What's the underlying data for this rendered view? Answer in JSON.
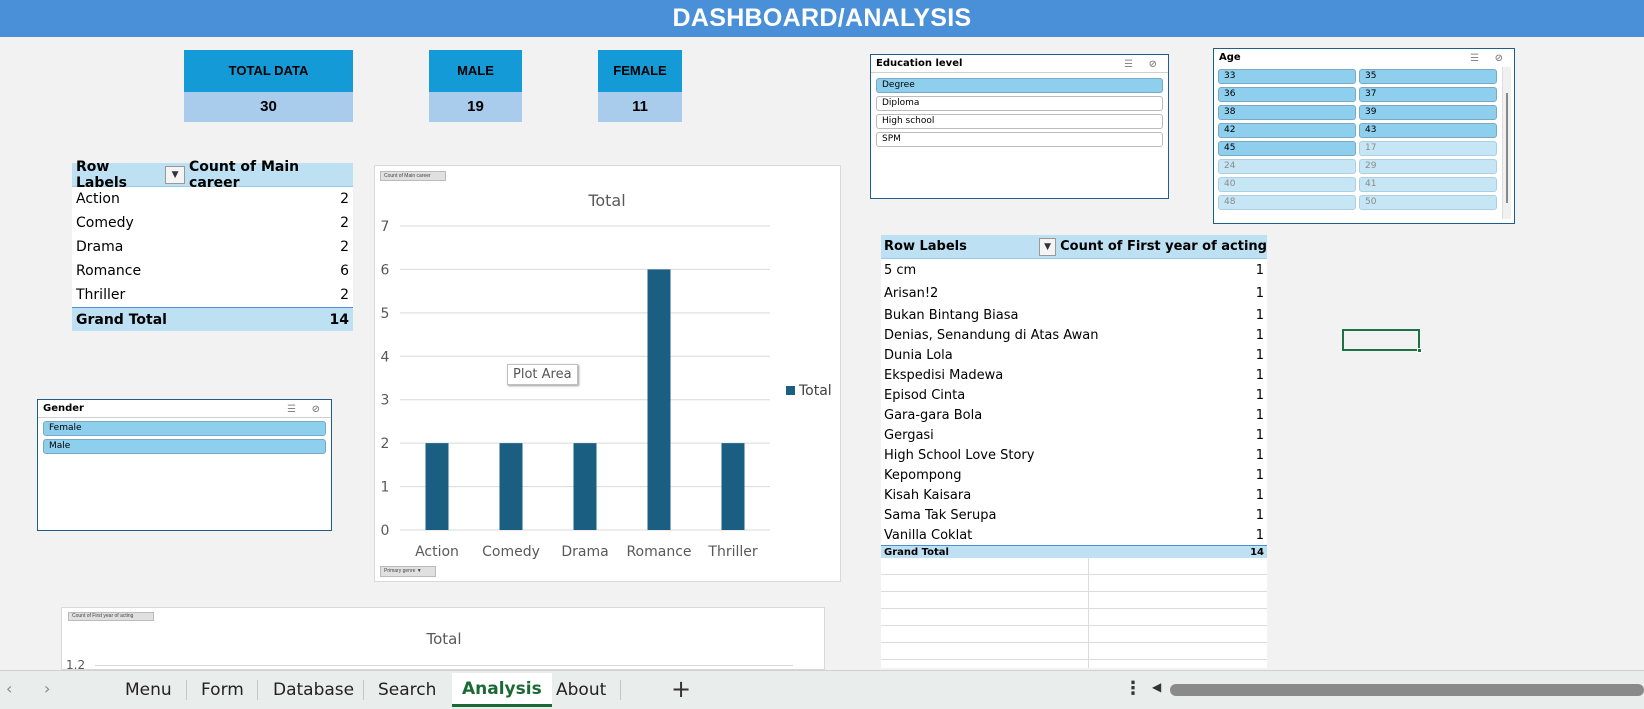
{
  "banner": {
    "title": "DASHBOARD/ANALYSIS"
  },
  "kpis": [
    {
      "label": "TOTAL DATA",
      "value": "30"
    },
    {
      "label": "MALE",
      "value": "19"
    },
    {
      "label": "FEMALE",
      "value": "11"
    }
  ],
  "pivot_career": {
    "col1": "Row Labels",
    "col2": "Count of Main career",
    "rows": [
      {
        "label": "Action",
        "count": "2"
      },
      {
        "label": "Comedy",
        "count": "2"
      },
      {
        "label": "Drama",
        "count": "2"
      },
      {
        "label": "Romance",
        "count": "6"
      },
      {
        "label": "Thriller",
        "count": "2"
      }
    ],
    "total_label": "Grand Total",
    "total_value": "14"
  },
  "gender_slicer": {
    "title": "Gender",
    "items": [
      "Female",
      "Male"
    ]
  },
  "education_slicer": {
    "title": "Education level",
    "selected": [
      "Degree"
    ],
    "items": [
      "Degree",
      "Diploma",
      "High school",
      "SPM"
    ]
  },
  "age_slicer": {
    "title": "Age",
    "selected": [
      "33",
      "35",
      "36",
      "37",
      "38",
      "39",
      "42",
      "43",
      "45"
    ],
    "no_data": [
      "17",
      "24",
      "29",
      "40",
      "41",
      "48",
      "50"
    ],
    "items": [
      "33",
      "35",
      "36",
      "37",
      "38",
      "39",
      "42",
      "43",
      "45",
      "17",
      "24",
      "29",
      "40",
      "41",
      "48",
      "50"
    ]
  },
  "main_chart": {
    "field_button": "Count of Main career",
    "axis_button": "Primary genre",
    "tooltip": "Plot Area",
    "chart_data": {
      "type": "bar",
      "title": "Total",
      "categories": [
        "Action",
        "Comedy",
        "Drama",
        "Romance",
        "Thriller"
      ],
      "series": [
        {
          "name": "Total",
          "values": [
            2,
            2,
            2,
            6,
            2
          ]
        }
      ],
      "ylim": [
        0,
        7
      ],
      "yticks": [
        0,
        1,
        2,
        3,
        4,
        5,
        6,
        7
      ],
      "color": "#1a5f82",
      "grid": true,
      "legend": "right"
    }
  },
  "bottom_chart": {
    "field_button": "Count of First year of acting",
    "title": "Total",
    "first_tick": "1.2"
  },
  "pivot_films": {
    "col1": "Row Labels",
    "col2": "Count of First year of acting",
    "rows": [
      {
        "label": "5 cm",
        "count": "1"
      },
      {
        "label": "Arisan!2",
        "count": "1"
      },
      {
        "label": "Bukan Bintang Biasa",
        "count": "1"
      },
      {
        "label": "Denias, Senandung di Atas Awan",
        "count": "1"
      },
      {
        "label": "Dunia Lola",
        "count": "1"
      },
      {
        "label": "Ekspedisi Madewa",
        "count": "1"
      },
      {
        "label": "Episod Cinta",
        "count": "1"
      },
      {
        "label": "Gara-gara Bola",
        "count": "1"
      },
      {
        "label": "Gergasi",
        "count": "1"
      },
      {
        "label": "High School Love Story",
        "count": "1"
      },
      {
        "label": "Kepompong",
        "count": "1"
      },
      {
        "label": "Kisah Kaisara",
        "count": "1"
      },
      {
        "label": "Sama Tak Serupa",
        "count": "1"
      },
      {
        "label": "Vanilla Coklat",
        "count": "1"
      }
    ],
    "total_label": "Grand Total",
    "total_value": "14"
  },
  "sheet_tabs": [
    "Menu",
    "Form",
    "Database",
    "Search",
    "Analysis",
    "About"
  ],
  "active_tab": "Analysis",
  "colors": {
    "banner": "#4a90d9",
    "kpi_header": "#149bd7",
    "kpi_value": "#a9cbec",
    "bar": "#1a5f82",
    "active_tab": "#1a6a36"
  }
}
